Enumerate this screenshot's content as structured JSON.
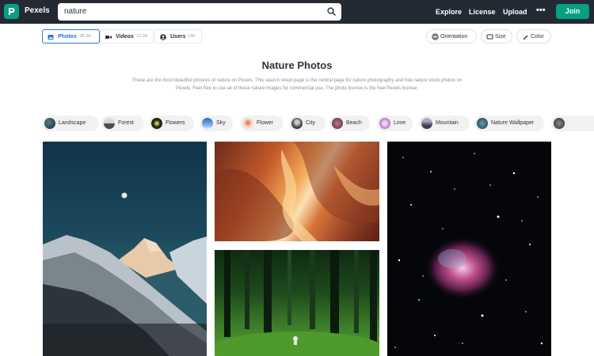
{
  "header": {
    "logo_text": "Pexels",
    "search_value": "nature",
    "nav": [
      "Explore",
      "License",
      "Upload"
    ],
    "more_label": "•••",
    "join_label": "Join"
  },
  "tabs": [
    {
      "label": "Photos",
      "count": "85.9K",
      "icon": "image-icon"
    },
    {
      "label": "Videos",
      "count": "12.3K",
      "icon": "video-icon"
    },
    {
      "label": "Users",
      "count": "146",
      "icon": "user-icon"
    }
  ],
  "filters": [
    {
      "label": "Orientation",
      "icon": "orientation-icon"
    },
    {
      "label": "Size",
      "icon": "size-icon"
    },
    {
      "label": "Color",
      "icon": "color-pen-icon"
    }
  ],
  "page": {
    "title": "Nature Photos",
    "description": "These are the most beautiful pictures of nature on Pexels. This search result page is the central page for nature photography and free nature stock photos on Pexels. Feel free to use all of these nature images for commercial use. The photo license is the free Pexels license."
  },
  "related": [
    {
      "label": "Landscape",
      "color": "#2b3f4a"
    },
    {
      "label": "Forest",
      "color": "#8a8f88"
    },
    {
      "label": "Flowers",
      "color": "#2f3a1e"
    },
    {
      "label": "Sky",
      "color": "#3a7fd0"
    },
    {
      "label": "Flower",
      "color": "#e8b7a8"
    },
    {
      "label": "City",
      "color": "#3a3c40"
    },
    {
      "label": "Beach",
      "color": "#6a4a56"
    },
    {
      "label": "Love",
      "color": "#c49ad0"
    },
    {
      "label": "Mountain",
      "color": "#4a4e60"
    },
    {
      "label": "Nature Wallpaper",
      "color": "#3a5a6a"
    },
    {
      "label": "",
      "color": "#3a3a3a"
    }
  ],
  "colors": {
    "brand": "#05a081",
    "topbar": "#232a34",
    "active_tab": "#3077d4"
  }
}
